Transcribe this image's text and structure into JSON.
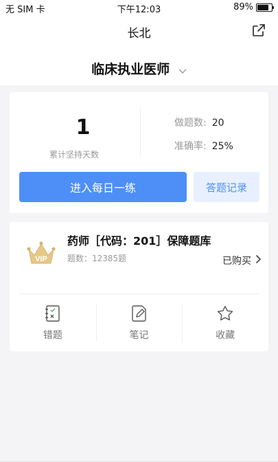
{
  "status_bar": {
    "carrier": "无 SIM 卡",
    "time": "下午12:03",
    "battery": "89%",
    "battery_level": 0.89
  },
  "nav": {
    "title": "长北",
    "share_icon": "share-icon"
  },
  "subject": {
    "label": "临床执业医师",
    "dropdown_icon": "chevron-down-icon"
  },
  "practice_card": {
    "days_value": "1",
    "days_label": "累计坚持天数",
    "stats": [
      {
        "label": "做题数:",
        "value": "20"
      },
      {
        "label": "准确率:",
        "value": "25%"
      }
    ],
    "daily_button": "进入每日一练",
    "records_button": "答题记录"
  },
  "bank_card": {
    "vip_badge": "VIP",
    "title": "药师［代码：201］保障题库",
    "count_label": "题数：12385题",
    "status": "已购买",
    "tools": [
      {
        "label": "错题",
        "icon": "wrong-questions-icon"
      },
      {
        "label": "笔记",
        "icon": "notes-icon"
      },
      {
        "label": "收藏",
        "icon": "star-icon"
      }
    ]
  },
  "colors": {
    "accent": "#4d8ff7",
    "accent_light": "#e8f0ff",
    "vip_gold": "#d9b36c"
  }
}
